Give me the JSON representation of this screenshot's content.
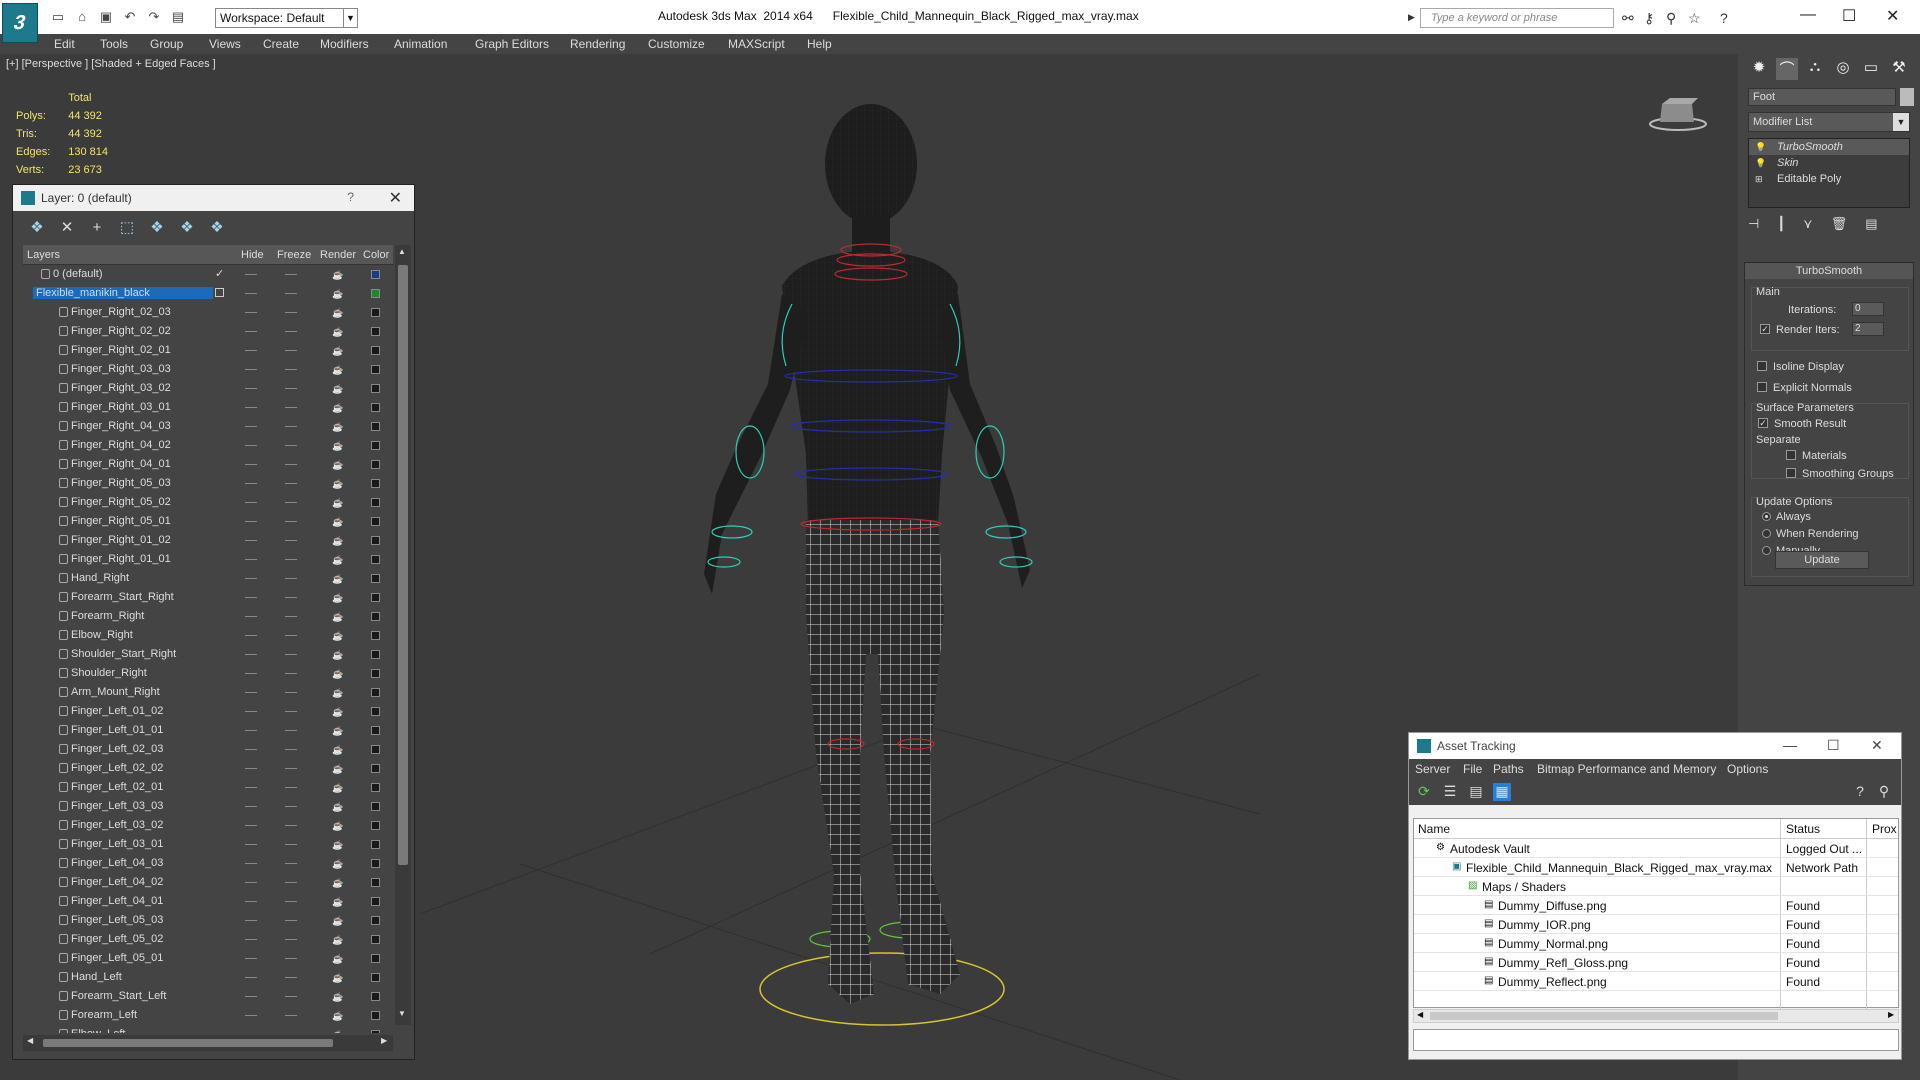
{
  "app": {
    "logo_letter": "3",
    "workspace": "Workspace: Default",
    "title": "Autodesk 3ds Max  2014 x64      Flexible_Child_Mannequin_Black_Rigged_max_vray.max",
    "search_placeholder": "Type a keyword or phrase"
  },
  "menu": [
    "Edit",
    "Tools",
    "Group",
    "Views",
    "Create",
    "Modifiers",
    "Animation",
    "Graph Editors",
    "Rendering",
    "Customize",
    "MAXScript",
    "Help"
  ],
  "viewport": {
    "label": "[+] [Perspective ] [Shaded + Edged Faces ]",
    "stats": {
      "header": "Total",
      "rows": [
        {
          "label": "Polys:",
          "value": "44 392"
        },
        {
          "label": "Tris:",
          "value": "44 392"
        },
        {
          "label": "Edges:",
          "value": "130 814"
        },
        {
          "label": "Verts:",
          "value": "23 673"
        }
      ]
    }
  },
  "layer_window": {
    "title": "Layer: 0 (default)",
    "help": "?",
    "columns": {
      "layers": "Layers",
      "hide": "Hide",
      "freeze": "Freeze",
      "render": "Render",
      "color": "Color"
    },
    "layers": [
      {
        "name": "0 (default)",
        "check": "✓",
        "color": "#1a3d8a"
      },
      {
        "name": "Flexible_manikin_black",
        "color": "#1a8a2a"
      }
    ],
    "objects": [
      "Finger_Right_02_03",
      "Finger_Right_02_02",
      "Finger_Right_02_01",
      "Finger_Right_03_03",
      "Finger_Right_03_02",
      "Finger_Right_03_01",
      "Finger_Right_04_03",
      "Finger_Right_04_02",
      "Finger_Right_04_01",
      "Finger_Right_05_03",
      "Finger_Right_05_02",
      "Finger_Right_05_01",
      "Finger_Right_01_02",
      "Finger_Right_01_01",
      "Hand_Right",
      "Forearm_Start_Right",
      "Forearm_Right",
      "Elbow_Right",
      "Shoulder_Start_Right",
      "Shoulder_Right",
      "Arm_Mount_Right",
      "Finger_Left_01_02",
      "Finger_Left_01_01",
      "Finger_Left_02_03",
      "Finger_Left_02_02",
      "Finger_Left_02_01",
      "Finger_Left_03_03",
      "Finger_Left_03_02",
      "Finger_Left_03_01",
      "Finger_Left_04_03",
      "Finger_Left_04_02",
      "Finger_Left_04_01",
      "Finger_Left_05_03",
      "Finger_Left_05_02",
      "Finger_Left_05_01",
      "Hand_Left",
      "Forearm_Start_Left",
      "Forearm_Left",
      "Elbow_Left"
    ]
  },
  "command_panel": {
    "object_name": "Foot",
    "modifier_list": "Modifier List",
    "stack": [
      "TurboSmooth",
      "Skin",
      "Editable Poly"
    ],
    "rollout_title": "TurboSmooth",
    "main_label": "Main",
    "iterations_label": "Iterations:",
    "iterations_value": "0",
    "render_iters_label": "Render Iters:",
    "render_iters_value": "2",
    "isoline": "Isoline Display",
    "explicit_normals": "Explicit Normals",
    "surface_params": "Surface Parameters",
    "smooth_result": "Smooth Result",
    "separate": "Separate",
    "materials": "Materials",
    "smoothing_groups": "Smoothing Groups",
    "update_options": "Update Options",
    "always": "Always",
    "when_rendering": "When Rendering",
    "manually": "Manually",
    "update_button": "Update"
  },
  "asset_tracking": {
    "title": "Asset Tracking",
    "menu": [
      "Server",
      "File",
      "Paths",
      "Bitmap Performance and Memory",
      "Options"
    ],
    "columns": {
      "name": "Name",
      "status": "Status",
      "proxy": "Prox"
    },
    "rows": [
      {
        "name": "Autodesk Vault",
        "status": "Logged Out ..."
      },
      {
        "name": "Flexible_Child_Mannequin_Black_Rigged_max_vray.max",
        "status": "Network Path"
      },
      {
        "name": "Maps / Shaders",
        "status": ""
      },
      {
        "name": "Dummy_Diffuse.png",
        "status": "Found"
      },
      {
        "name": "Dummy_IOR.png",
        "status": "Found"
      },
      {
        "name": "Dummy_Normal.png",
        "status": "Found"
      },
      {
        "name": "Dummy_Refl_Gloss.png",
        "status": "Found"
      },
      {
        "name": "Dummy_Reflect.png",
        "status": "Found"
      }
    ]
  }
}
